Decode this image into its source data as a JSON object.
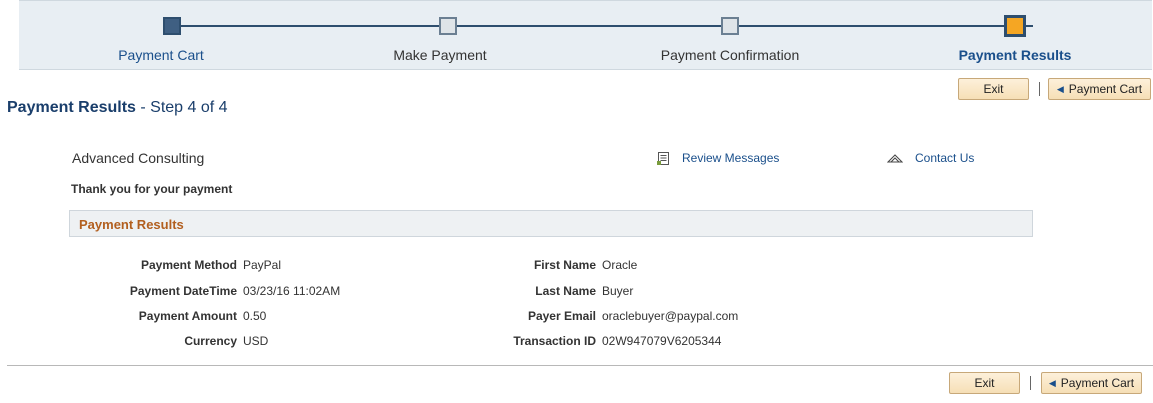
{
  "train": {
    "stops": [
      {
        "label": "Payment Cart",
        "state": "done"
      },
      {
        "label": "Make Payment",
        "state": "pending"
      },
      {
        "label": "Payment Confirmation",
        "state": "pending"
      },
      {
        "label": "Payment Results",
        "state": "current"
      }
    ]
  },
  "nav": {
    "exit_label": "Exit",
    "payment_cart_label": "Payment Cart"
  },
  "header": {
    "title": "Payment Results",
    "step": "- Step 4 of 4",
    "company": "Advanced Consulting",
    "review_messages": "Review Messages",
    "contact_us": "Contact Us",
    "thanks": "Thank you for your payment"
  },
  "results": {
    "section_title": "Payment Results",
    "left": [
      {
        "label": "Payment Method",
        "value": "PayPal"
      },
      {
        "label": "Payment DateTime",
        "value": "03/23/16 11:02AM"
      },
      {
        "label": "Payment Amount",
        "value": "0.50"
      },
      {
        "label": "Currency",
        "value": "USD"
      }
    ],
    "right": [
      {
        "label": "First Name",
        "value": "Oracle"
      },
      {
        "label": "Last Name",
        "value": "Buyer"
      },
      {
        "label": "Payer Email",
        "value": "oraclebuyer@paypal.com"
      },
      {
        "label": "Transaction ID",
        "value": "02W947079V6205344"
      }
    ]
  },
  "icons": {
    "done_stop": "square-filled-icon",
    "pending_stop": "square-empty-icon",
    "current_stop": "square-highlight-icon",
    "back_arrow": "triangle-left-icon",
    "review": "document-list-icon",
    "contact": "envelope-open-icon"
  },
  "colors": {
    "link": "#1a4f8b",
    "title": "#1a3e6b",
    "section_title": "#b25f1f",
    "current_stop": "#f5a623",
    "button": "#f6dfb6"
  }
}
